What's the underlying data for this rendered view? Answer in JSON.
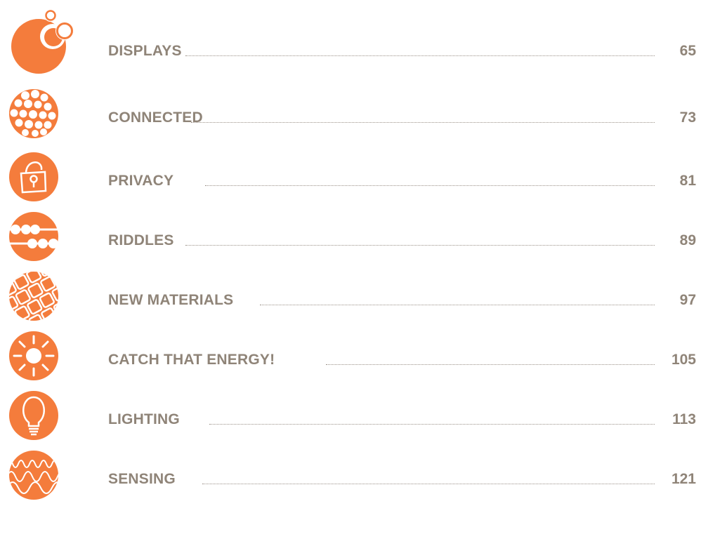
{
  "accent_color": "#f47c3c",
  "text_color": "#8f8478",
  "entries": [
    {
      "icon": "bubbles-icon",
      "title": "DISPLAYS",
      "page": "65"
    },
    {
      "icon": "dots-cluster-icon",
      "title": "CONNECTED",
      "page": "73"
    },
    {
      "icon": "padlock-icon",
      "title": "PRIVACY",
      "page": "81"
    },
    {
      "icon": "beads-icon",
      "title": "RIDDLES",
      "page": "89"
    },
    {
      "icon": "tiles-icon",
      "title": "NEW MATERIALS",
      "page": "97"
    },
    {
      "icon": "sun-icon",
      "title": "CATCH THAT ENERGY!",
      "page": "105"
    },
    {
      "icon": "lightbulb-icon",
      "title": "LIGHTING",
      "page": "113"
    },
    {
      "icon": "waves-icon",
      "title": "SENSING",
      "page": "121"
    }
  ]
}
